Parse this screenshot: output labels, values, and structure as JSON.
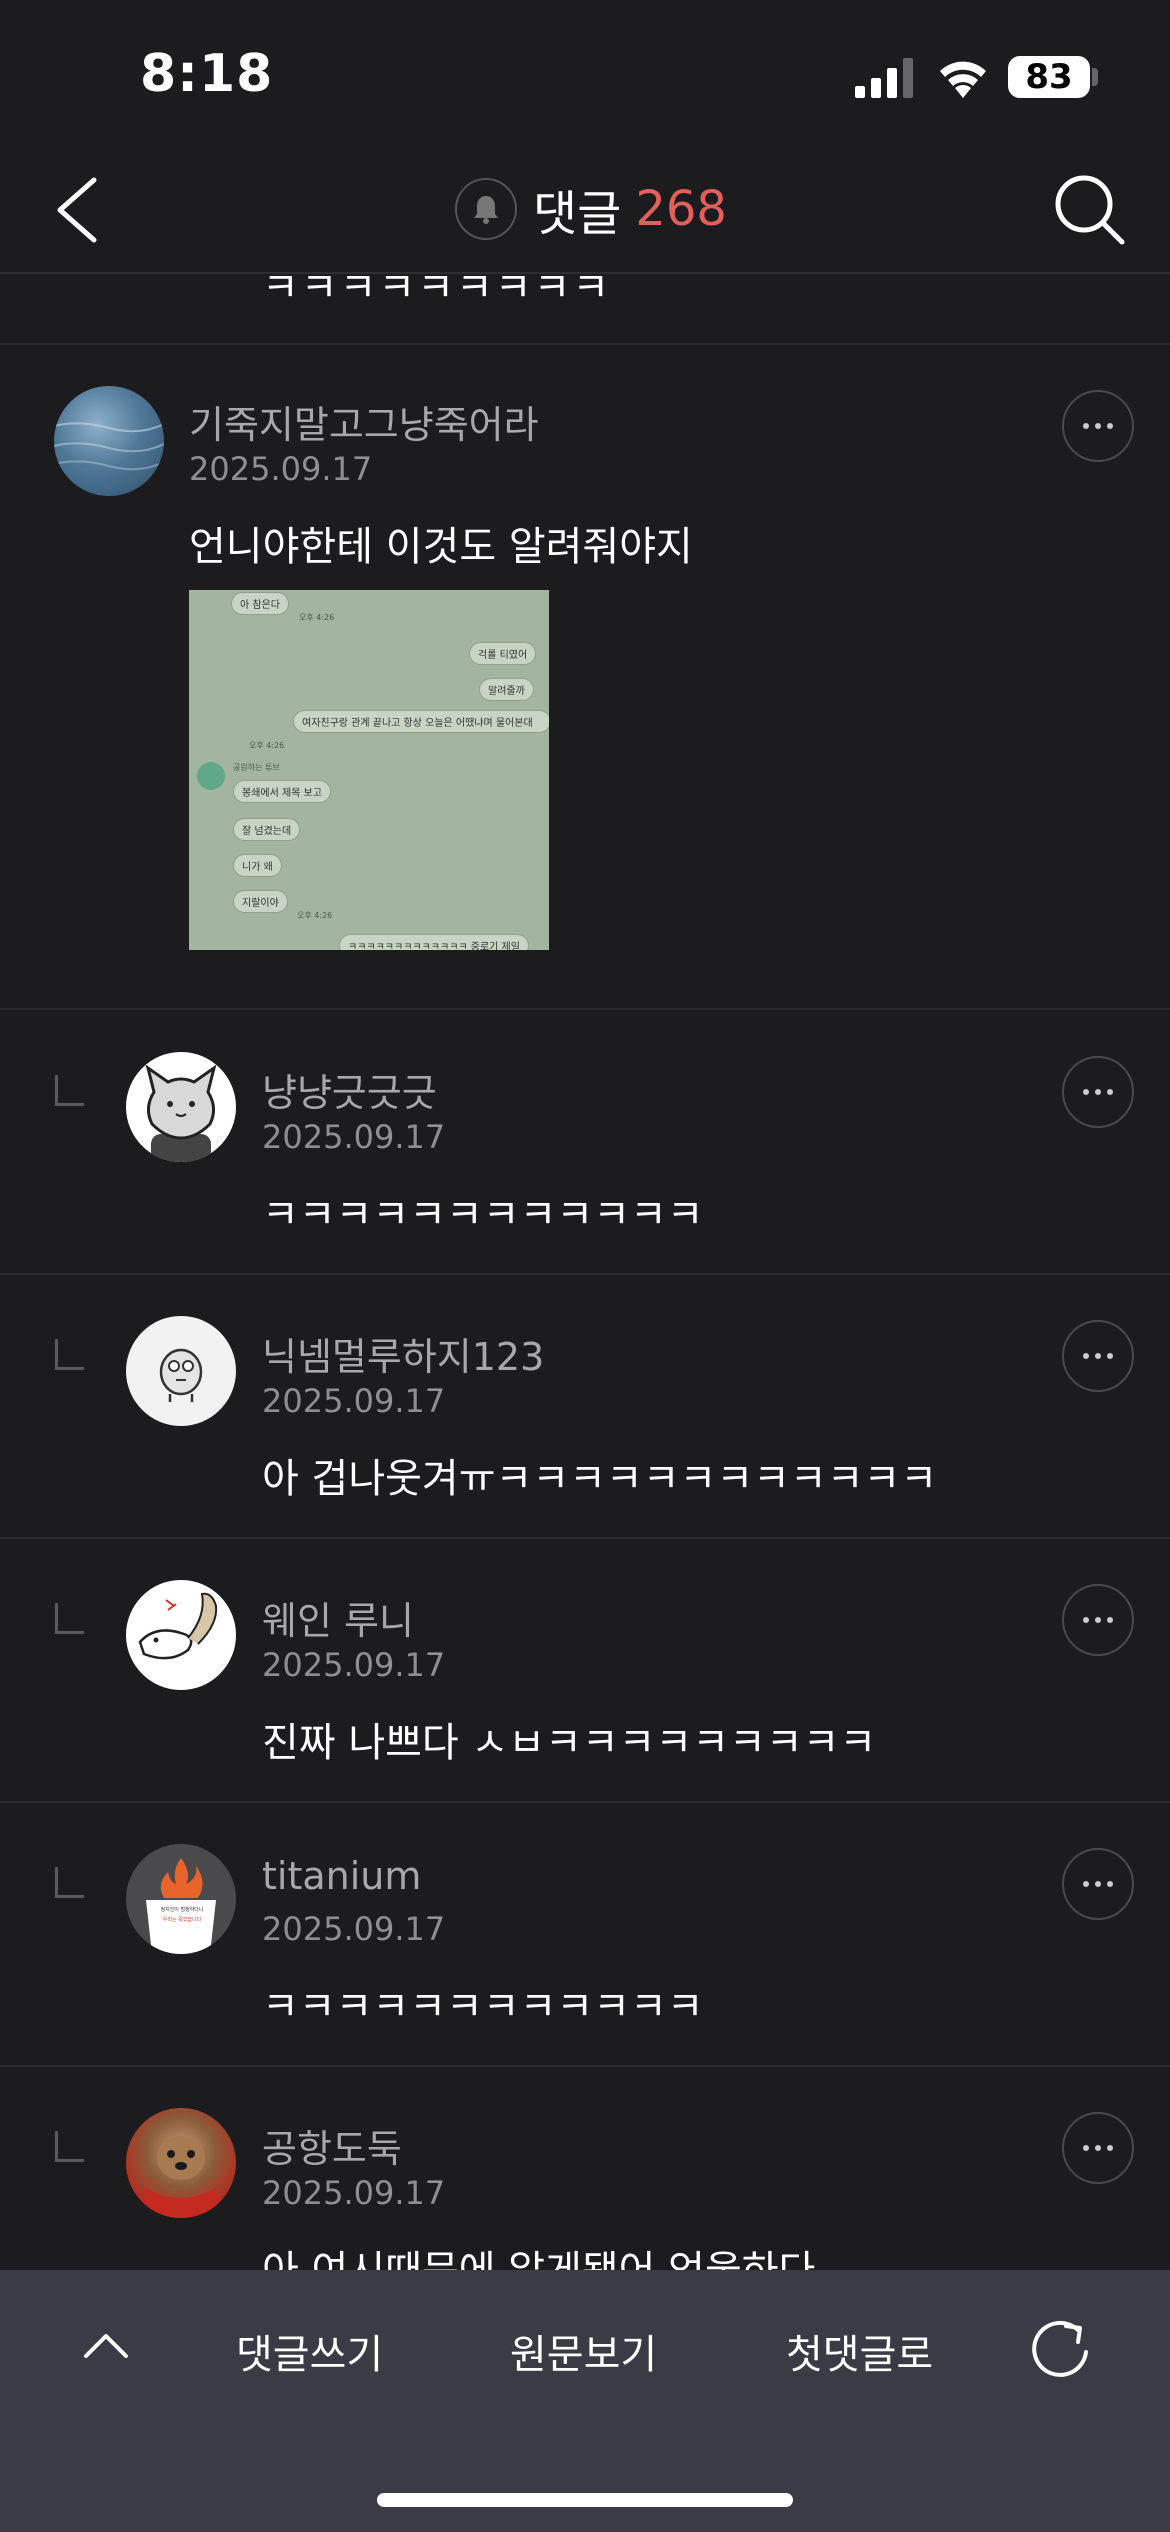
{
  "status_bar": {
    "time": "8:18",
    "battery": "83"
  },
  "nav": {
    "title": "댓글",
    "count": "268"
  },
  "partial_previous_comment": "ㅋㅋㅋㅋㅋㅋㅋㅋㅋ",
  "comments": [
    {
      "author": "기죽지말고그냥죽어라",
      "date": "2025.09.17",
      "text": "언니야한테 이것도 알려줘야지",
      "has_image": true,
      "image_chat": {
        "bubbles": [
          "아 참은다",
          "걱롤 티였어",
          "알려줄까",
          "여자친구랑 관계 끝나고 항상 오늘은 어땠냐며 물어본대",
          "봉쇄에서 제목 보고",
          "잘 넘겼는데",
          "니가 왜",
          "지랄이야",
          "ㅋㅋㅋㅋㅋㅋㅋㅋㅋㅋㅋㅋㅋ 중로기 제일"
        ],
        "sender": "공원하는 튜브",
        "times": [
          "오후 4:26",
          "오후 4:26",
          "오후 4:26"
        ]
      }
    },
    {
      "author": "냥냥긋긋긋",
      "date": "2025.09.17",
      "text": "ㅋㅋㅋㅋㅋㅋㅋㅋㅋㅋㅋㅋ",
      "reply": true
    },
    {
      "author": "닉넴멀루하지123",
      "date": "2025.09.17",
      "text": "아 겁나웃겨ㅠㅋㅋㅋㅋㅋㅋㅋㅋㅋㅋㅋㅋ",
      "reply": true
    },
    {
      "author": "웨인 루니",
      "date": "2025.09.17",
      "text": "진짜 나쁘다 ㅅㅂㅋㅋㅋㅋㅋㅋㅋㅋㅋ",
      "reply": true
    },
    {
      "author": "titanium",
      "date": "2025.09.17",
      "text": "ㅋㅋㅋㅋㅋㅋㅋㅋㅋㅋㅋㅋ",
      "reply": true,
      "avatar_text": [
        "정치인이 멍청하다니",
        "우리는 죽었습니다"
      ]
    },
    {
      "author": "공항도둑",
      "date": "2025.09.17",
      "text": "아 여시때문에 알게됐어 억울하다",
      "reply": true
    }
  ],
  "bottom_bar": {
    "write": "댓글쓰기",
    "original": "원문보기",
    "first": "첫댓글로"
  },
  "colors": {
    "accent": "#e0605c",
    "background": "#1c1c1e",
    "bottom_bar": "#3a3b44"
  },
  "icons": [
    "back-icon",
    "bell-icon",
    "search-icon",
    "more-icon",
    "chevron-up-icon",
    "refresh-icon"
  ]
}
